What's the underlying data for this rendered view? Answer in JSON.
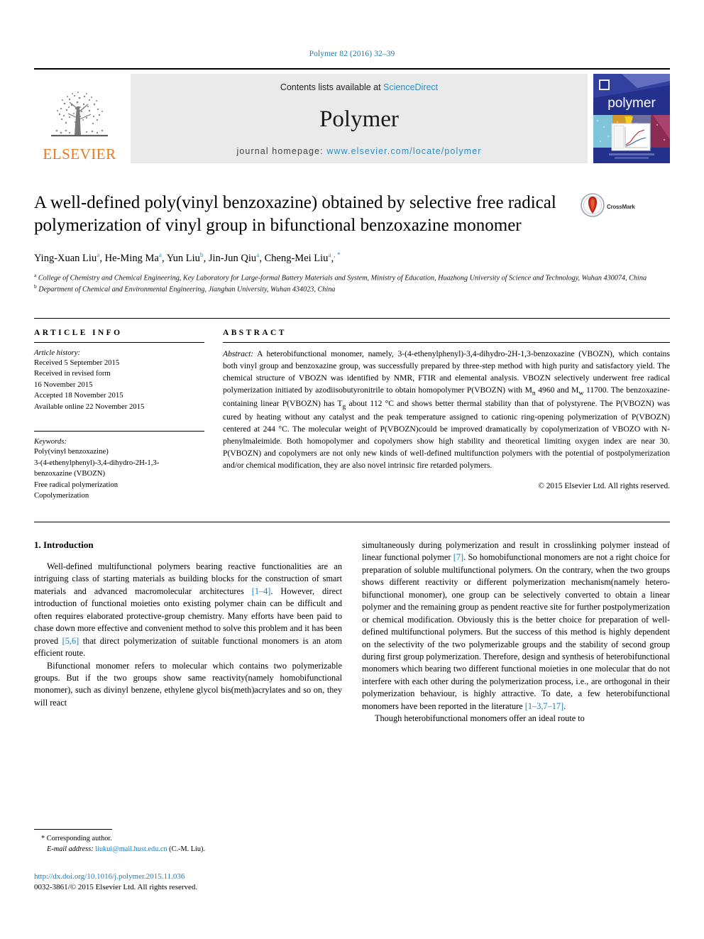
{
  "running_head": "Polymer 82 (2016) 32–39",
  "banner": {
    "publisher_name": "ELSEVIER",
    "contents_prefix": "Contents lists available at ",
    "contents_link": "ScienceDirect",
    "journal_title": "Polymer",
    "homepage_prefix": "journal homepage: ",
    "homepage_url": "www.elsevier.com/locate/polymer",
    "cover_word": "polymer"
  },
  "article": {
    "title": "A well-defined poly(vinyl benzoxazine) obtained by selective free radical polymerization of vinyl group in bifunctional benzoxazine monomer",
    "crossmark_label": "CrossMark",
    "authors": "Ying-Xuan Liu a, He-Ming Ma a, Yun Liu b, Jin-Jun Qiu a, Cheng-Mei Liu a, *",
    "affiliation_a": "a College of Chemistry and Chemical Engineering, Key Laboratory for Large-formal Battery Materials and System, Ministry of Education, Huazhong University of Science and Technology, Wuhan 430074, China",
    "affiliation_b": "b Department of Chemical and Environmental Engineering, Jianghan University, Wuhan 434023, China"
  },
  "article_info": {
    "heading": "ARTICLE INFO",
    "history_label": "Article history:",
    "history": [
      "Received 5 September 2015",
      "Received in revised form",
      "16 November 2015",
      "Accepted 18 November 2015",
      "Available online 22 November 2015"
    ],
    "keywords_label": "Keywords:",
    "keywords": [
      "Poly(vinyl benzoxazine)",
      "3-(4-ethenylphenyl)-3,4-dihydro-2H-1,3-",
      "benzoxazine (VBOZN)",
      "Free radical polymerization",
      "Copolymerization"
    ]
  },
  "abstract": {
    "heading": "ABSTRACT",
    "label": "Abstract:",
    "text": " A heterobifunctional monomer, namely, 3-(4-ethenylphenyl)-3,4-dihydro-2H-1,3-benzoxazine (VBOZN), which contains both vinyl group and benzoxazine group, was successfully prepared by three-step method with high purity and satisfactory yield. The chemical structure of VBOZN was identified by NMR, FTIR and elemental analysis. VBOZN selectively underwent free radical polymerization initiated by azodiisobutyronitrile to obtain homopolymer P(VBOZN) with Mn 4960 and Mw 11700. The benzoxazine-containing linear P(VBOZN) has Tg about 112 °C and shows better thermal stability than that of polystyrene. The P(VBOZN) was cured by heating without any catalyst and the peak temperature assigned to cationic ring-opening polymerization of P(VBOZN) centered at 244 °C. The molecular weight of P(VBOZN)could be improved dramatically by copolymerization of VBOZO with N-phenylmaleimide. Both homopolymer and copolymers show high stability and theoretical limiting oxygen index are near 30. P(VBOZN) and copolymers are not only new kinds of well-defined multifunction polymers with the potential of postpolymerization and/or chemical modification, they are also novel intrinsic fire retarded polymers.",
    "copyright": "© 2015 Elsevier Ltd. All rights reserved."
  },
  "introduction": {
    "heading": "1. Introduction",
    "left_paragraphs": [
      "Well-defined multifunctional polymers bearing reactive functionalities are an intriguing class of starting materials as building blocks for the construction of smart materials and advanced macromolecular architectures [1–4]. However, direct introduction of functional moieties onto existing polymer chain can be difficult and often requires elaborated protective-group chemistry. Many efforts have been paid to chase down more effective and convenient method to solve this problem and it has been proved [5,6] that direct polymerization of suitable functional monomers is an atom efficient route.",
      "Bifunctional monomer refers to molecular which contains two polymerizable groups. But if the two groups show same reactivity(namely homobifunctional monomer), such as divinyl benzene, ethylene glycol bis(meth)acrylates and so on, they will react"
    ],
    "right_paragraphs": [
      "simultaneously during polymerization and result in crosslinking polymer instead of linear functional polymer [7]. So homobifunctional monomers are not a right choice for preparation of soluble multifunctional polymers. On the contrary, when the two groups shows different reactivity or different polymerization mechanism(namely hetero-bifunctional monomer), one group can be selectively converted to obtain a linear polymer and the remaining group as pendent reactive site for further postpolymerization or chemical modification. Obviously this is the better choice for preparation of well-defined multifunctional polymers. But the success of this method is highly dependent on the selectivity of the two polymerizable groups and the stability of second group during first group polymerization. Therefore, design and synthesis of heterobifunctional monomers which bearing two different functional moieties in one molecular that do not interfere with each other during the polymerization process, i.e., are orthogonal in their polymerization behaviour, is highly attractive. To date, a few heterobifunctional monomers have been reported in the literature [1–3,7–17].",
      "Though heterobifunctional monomers offer an ideal route to"
    ]
  },
  "footnote": {
    "corresponding": "* Corresponding author.",
    "email_label": "E-mail address:",
    "email": "liukui@mail.hust.edu.cn",
    "email_suffix": "(C.-M. Liu)."
  },
  "footer": {
    "doi": "http://dx.doi.org/10.1016/j.polymer.2015.11.036",
    "issn_line": "0032-3861/© 2015 Elsevier Ltd. All rights reserved."
  },
  "colors": {
    "link_blue": "#1a7bb9",
    "banner_link_blue": "#2e8ec4",
    "elsevier_orange": "#e87722",
    "cover_navy": "#23308c",
    "banner_gray": "#eaeaea"
  }
}
